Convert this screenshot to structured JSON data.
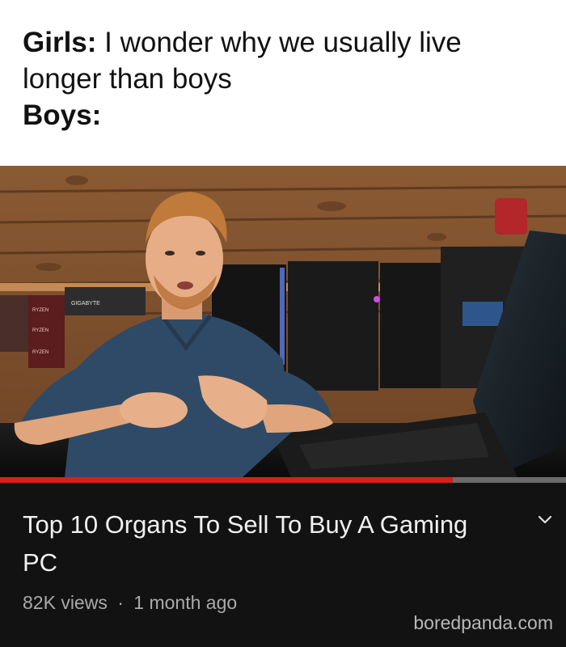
{
  "caption": {
    "girls_label": "Girls:",
    "girls_text_line1": "I wonder why we usually live",
    "girls_text_line2": "longer than boys",
    "boys_label": "Boys:"
  },
  "video": {
    "box_brands": [
      "GIGABYTE",
      "RYZEN",
      "RYZEN",
      "RYZEN"
    ],
    "progress_fraction": 0.8,
    "title": "Top 10 Organs To Sell To Buy A Gaming PC",
    "views": "82K views",
    "separator": "·",
    "age": "1 month ago",
    "expand_icon": "chevron-down-icon"
  },
  "watermark": "boredpanda.com",
  "colors": {
    "progress_played": "#d8201b",
    "progress_track": "#6b6b6b",
    "panel_background": "#121212",
    "title_text": "#f1f1f1",
    "meta_text": "#aaaaaa"
  }
}
